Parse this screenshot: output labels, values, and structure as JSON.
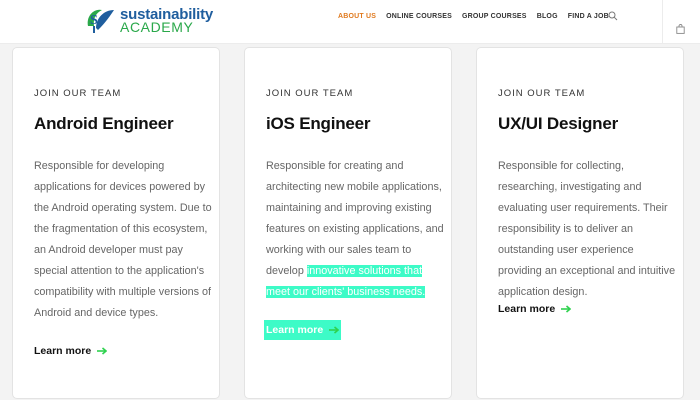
{
  "logo": {
    "line1": "sustainability",
    "line2": "ACADEMY"
  },
  "nav": {
    "items": [
      "ABOUT US",
      "ONLINE COURSES",
      "GROUP COURSES",
      "BLOG",
      "FIND A JOB"
    ],
    "active_index": 0
  },
  "colors": {
    "accent": "#e07a1f",
    "link_arrow": "#2fd24f",
    "highlight": "#3dfbc7"
  },
  "cards": [
    {
      "eyebrow": "JOIN OUR TEAM",
      "title": "Android Engineer",
      "description": "Responsible for developing applications for devices powered by the Android operating system. Due to the fragmentation of this ecosystem, an Android developer must pay special attention to the application's compatibility with multiple versions of Android and device types.",
      "link": "Learn more"
    },
    {
      "eyebrow": "JOIN OUR TEAM",
      "title": "iOS Engineer",
      "description": "Responsible for creating and architecting new mobile applications, maintaining and improving existing features on existing applications, and working with our sales team to develop",
      "description_highlight": "innovative solutions that meet our clients' business needs.",
      "link": "Learn more"
    },
    {
      "eyebrow": "JOIN OUR TEAM",
      "title": "UX/UI Designer",
      "description": "Responsible for collecting, researching, investigating and evaluating user requirements. Their responsibility is to deliver an outstanding user experience providing an exceptional and intuitive application design.",
      "link": "Learn more"
    }
  ]
}
